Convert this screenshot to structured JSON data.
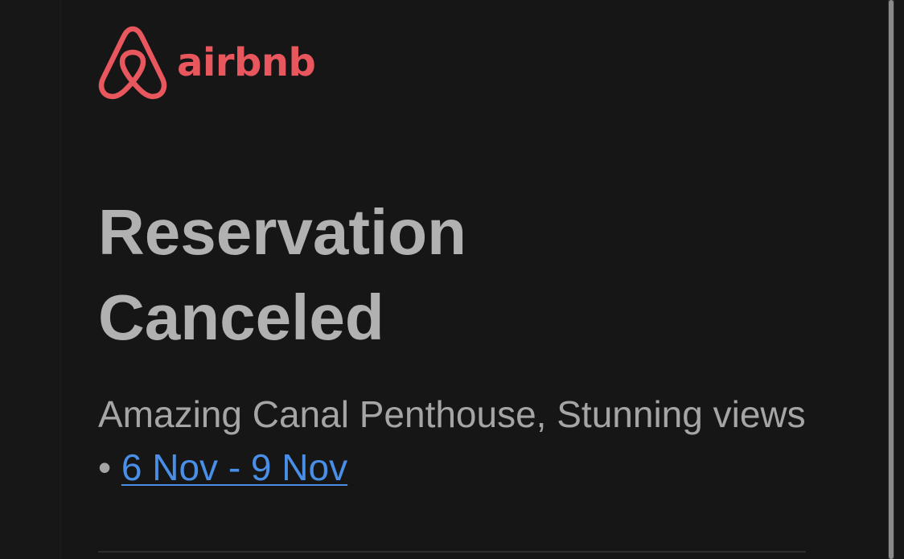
{
  "brand": {
    "name": "airbnb",
    "logo_icon": "airbnb-belo-icon",
    "color": "#e9575e"
  },
  "email": {
    "title_line1": "Reservation",
    "title_line2": "Canceled",
    "listing_name": "Amazing Canal Penthouse, Stunning views",
    "separator": "•",
    "dates": "6 Nov - 9 Nov"
  },
  "colors": {
    "background": "#171717",
    "title": "#b1b1b1",
    "subtitle": "#a5a5a5",
    "link": "#4a8fe7"
  }
}
